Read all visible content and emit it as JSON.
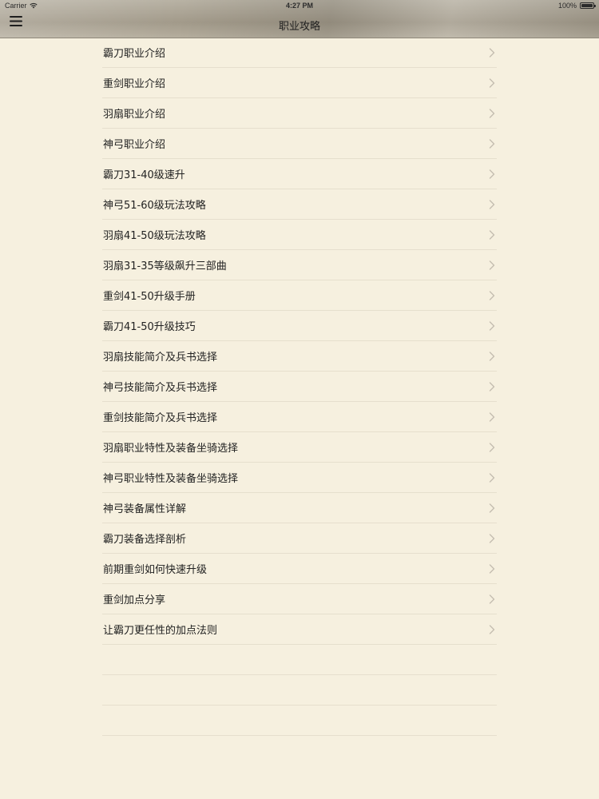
{
  "status_bar": {
    "carrier": "Carrier",
    "time": "4:27 PM",
    "battery": "100%"
  },
  "nav": {
    "title": "职业攻略"
  },
  "items": [
    {
      "label": "霸刀职业介绍"
    },
    {
      "label": "重剑职业介绍"
    },
    {
      "label": "羽扇职业介绍"
    },
    {
      "label": "神弓职业介绍"
    },
    {
      "label": "霸刀31-40级速升"
    },
    {
      "label": "神弓51-60级玩法攻略"
    },
    {
      "label": "羽扇41-50级玩法攻略"
    },
    {
      "label": "羽扇31-35等级飙升三部曲"
    },
    {
      "label": "重剑41-50升级手册"
    },
    {
      "label": "霸刀41-50升级技巧"
    },
    {
      "label": "羽扇技能简介及兵书选择"
    },
    {
      "label": "神弓技能简介及兵书选择"
    },
    {
      "label": "重剑技能简介及兵书选择"
    },
    {
      "label": "羽扇职业特性及装备坐骑选择"
    },
    {
      "label": "神弓职业特性及装备坐骑选择"
    },
    {
      "label": "神弓装备属性详解"
    },
    {
      "label": "霸刀装备选择剖析"
    },
    {
      "label": "前期重剑如何快速升级"
    },
    {
      "label": "重剑加点分享"
    },
    {
      "label": "让霸刀更任性的加点法则"
    }
  ],
  "icons": {
    "menu": "hamburger-menu-icon",
    "chevron": "chevron-right-icon",
    "wifi": "wifi-icon",
    "battery": "battery-icon"
  },
  "colors": {
    "background": "#f6f0df",
    "separator": "#e6dfcd",
    "text": "#222222",
    "chevron": "#c4bdb0"
  }
}
